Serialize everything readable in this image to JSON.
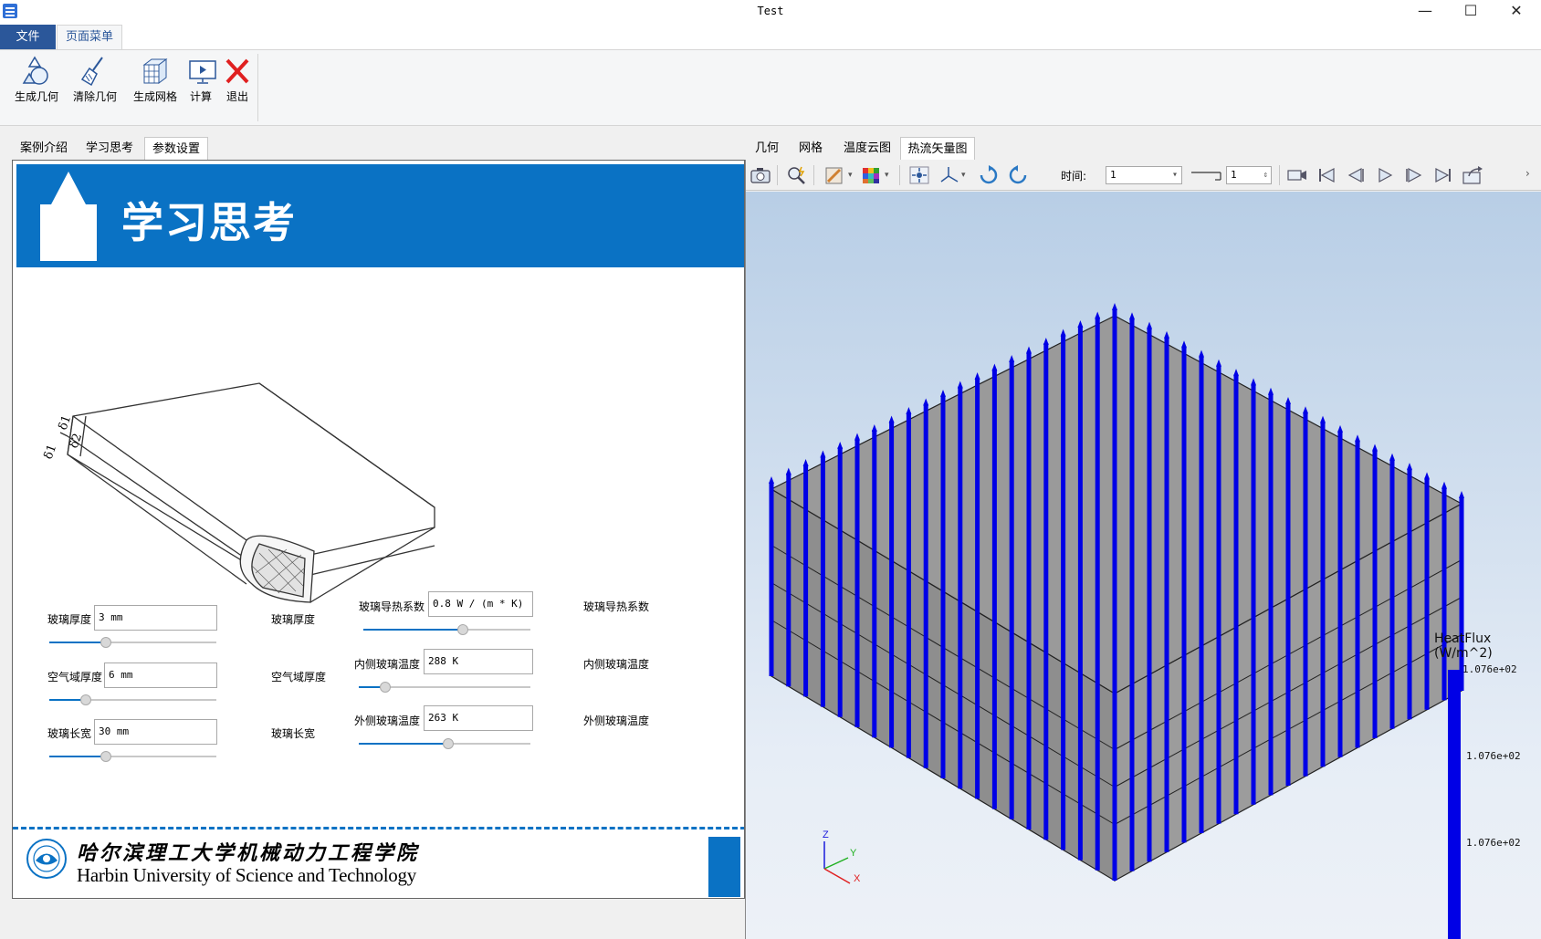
{
  "window": {
    "title": "Test",
    "minimize_glyph": "—",
    "maximize_glyph": "☐",
    "close_glyph": "✕"
  },
  "ribbon": {
    "tabs": [
      {
        "label": "文件",
        "active": false
      },
      {
        "label": "页面菜单",
        "active": true
      }
    ],
    "buttons": [
      {
        "label": "生成几何",
        "icon": "geometry-shapes-icon"
      },
      {
        "label": "清除几何",
        "icon": "broom-icon"
      },
      {
        "label": "生成网格",
        "icon": "mesh-cube-icon"
      },
      {
        "label": "计算",
        "icon": "monitor-play-icon"
      },
      {
        "label": "退出",
        "icon": "red-x-icon"
      }
    ]
  },
  "left_tabs": [
    {
      "label": "案例介绍",
      "active": false
    },
    {
      "label": "学习思考",
      "active": false
    },
    {
      "label": "参数设置",
      "active": true
    }
  ],
  "banner": {
    "title": "学习思考",
    "accent": "#0a72c4"
  },
  "diagram": {
    "dimension_labels": [
      "δ1",
      "δ2",
      "δ1"
    ]
  },
  "params": {
    "glass_thickness": {
      "label": "玻璃厚度",
      "value": "3 mm",
      "echo": "玻璃厚度",
      "slider": 0.33
    },
    "air_thickness": {
      "label": "空气域厚度",
      "value": "6 mm",
      "echo": "空气域厚度",
      "slider": 0.2
    },
    "glass_length": {
      "label": "玻璃长宽",
      "value": "30 mm",
      "echo": "玻璃长宽",
      "slider": 0.33
    },
    "glass_conductivity": {
      "label": "玻璃导热系数",
      "value": "0.8 W / (m * K)",
      "echo": "玻璃导热系数",
      "slider": 0.6
    },
    "inner_temp": {
      "label": "内侧玻璃温度",
      "value": "288 K",
      "echo": "内侧玻璃温度",
      "slider": 0.13
    },
    "outer_temp": {
      "label": "外侧玻璃温度",
      "value": "263 K",
      "echo": "外侧玻璃温度",
      "slider": 0.52
    }
  },
  "footer": {
    "institute_cn": "哈尔滨理工大学机械动力工程学院",
    "institute_en": "Harbin University of Science and Technology"
  },
  "viewer_tabs": [
    {
      "label": "几何",
      "active": false
    },
    {
      "label": "网格",
      "active": false
    },
    {
      "label": "温度云图",
      "active": false
    },
    {
      "label": "热流矢量图",
      "active": true
    }
  ],
  "viewer_toolbar": {
    "time_label": "时间:",
    "time_value": "1",
    "step_value": "1",
    "icons": [
      "camera-icon",
      "zoom-icon",
      "display-mode-icon",
      "color-map-icon",
      "fit-view-icon",
      "axis-orient-icon",
      "rotate-cw-icon",
      "rotate-ccw-icon",
      "record-icon",
      "first-frame-icon",
      "prev-frame-icon",
      "play-icon",
      "next-frame-icon",
      "last-frame-icon",
      "export-icon"
    ]
  },
  "legend": {
    "title_line1": "HeatFlux",
    "title_line2": "(W/m^2)",
    "ticks": [
      "1.076e+02",
      "1.076e+02",
      "1.076e+02"
    ],
    "color": "#0000e6"
  },
  "triad": {
    "z": "Z",
    "y": "Y",
    "x": "X"
  }
}
